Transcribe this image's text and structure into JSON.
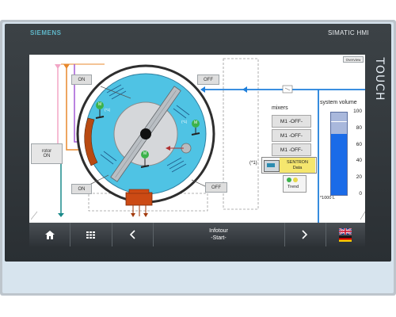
{
  "device": {
    "brand": "SIEMENS",
    "model": "SIMATIC HMI",
    "side_label": "TOUCH"
  },
  "screen": {
    "tag": "Overview",
    "buttons": {
      "on_top": "ON",
      "off_top": "OFF",
      "on_bottom": "ON",
      "off_bottom": "OFF"
    },
    "rotor": {
      "line1": "rotor",
      "line2": "ON"
    },
    "motor_label": "M",
    "motor_sub": "(*1)",
    "mixers": {
      "title": "mixers",
      "items": [
        "M1 -OFF-",
        "M1 -OFF-",
        "M1 -OFF-"
      ]
    },
    "sentron": {
      "marker": "(*1)",
      "line1": "SENTRON",
      "line2": "Data"
    },
    "trend_label": "Trend",
    "volume": {
      "title": "system volume",
      "ticks": [
        "100",
        "80",
        "60",
        "40",
        "20",
        "0"
      ],
      "unit": "*1000 L",
      "level": 0.74,
      "setpoint": 0.88
    }
  },
  "taskbar": {
    "infotour_line1": "Infotour",
    "infotour_line2": "-Start-",
    "icons": [
      "home-icon",
      "grid-icon",
      "chevron-left-icon",
      "chevron-right-icon",
      "uk-flag-icon",
      "german-flag-icon"
    ]
  },
  "colors": {
    "tank": "#4fc3e4",
    "pipe_blue": "#1f7fdb",
    "motor_green": "#3cb24a",
    "hopper": "#cc4a14",
    "bar_fill": "#1a6be8",
    "bar_empty": "#a9b8dc"
  }
}
